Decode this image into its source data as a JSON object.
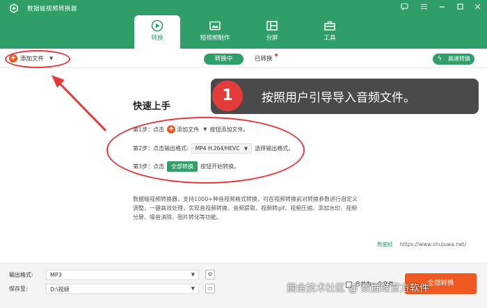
{
  "app": {
    "title": "数据蛙视频转换器"
  },
  "window_controls": [
    "feedback-icon",
    "menu-icon",
    "minimize-icon",
    "maximize-icon",
    "close-icon"
  ],
  "tabs": [
    {
      "label": "转换",
      "icon": "convert-icon",
      "active": true
    },
    {
      "label": "短视频制作",
      "icon": "video-maker-icon",
      "active": false
    },
    {
      "label": "分屏",
      "icon": "split-screen-icon",
      "active": false
    },
    {
      "label": "工具",
      "icon": "toolbox-icon",
      "active": false
    }
  ],
  "toolbar": {
    "add_file": "添加文件",
    "converting": "转换中",
    "converted": "已转换",
    "fast_convert": "高速转换"
  },
  "guide": {
    "title": "快速上手",
    "step1": {
      "prefix": "第1步：点击",
      "button": "添加文件",
      "suffix": "按钮添加文件。"
    },
    "step2": {
      "prefix": "第2步：点击输出格式:",
      "format": "MP4 H.264/HEVC",
      "suffix": "选择输出格式。"
    },
    "step3": {
      "prefix": "第3步：点击",
      "button": "全部转换",
      "suffix": "按钮开始转换。"
    }
  },
  "description": "数据蛙视频转换器，支持1000+种音视频格式转换，可在视频转换前对转换参数进行自定义调整，一键高效处理，实现音视频转换、音频提取、视频转gif、视频压缩、添加水印、视频分屏、噪音消除、图片转化等功能。",
  "brand": {
    "name": "数据蛙",
    "url": "https://www.shujuwa.net/"
  },
  "callout": {
    "number": "1",
    "text": "按照用户引导导入音频文件。"
  },
  "bottom": {
    "output_format_label": "输出格式:",
    "output_format_value": "MP3",
    "save_to_label": "保存至:",
    "save_to_value": "D:\\视频",
    "merge_label": "合并为一个文件",
    "convert_all": "全部转换"
  },
  "watermark": "掘金技术社区 @ 数据蛙官方软件",
  "colors": {
    "brand_green": "#2f9e69",
    "accent_orange": "#f05a22",
    "annotation_red": "#e8363b"
  }
}
